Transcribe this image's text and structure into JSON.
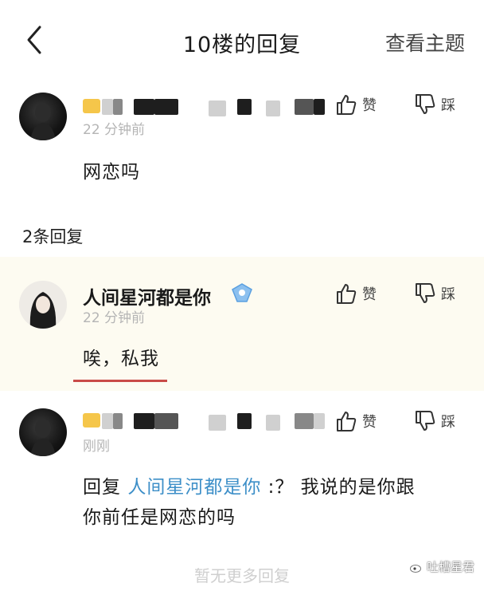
{
  "header": {
    "title": "10楼的回复",
    "right_link": "查看主题"
  },
  "main_comment": {
    "time": "22 分钟前",
    "text": "网恋吗",
    "like_label": "赞",
    "dislike_label": "踩"
  },
  "reply_count": "2条回复",
  "replies": [
    {
      "username": "人间星河都是你",
      "time": "22 分钟前",
      "text": "唉，私我",
      "like_label": "赞",
      "dislike_label": "踩"
    },
    {
      "time": "刚刚",
      "reply_prefix": "回复",
      "reply_to": "人间星河都是你",
      "text_line1": ":？ 我说的是你跟",
      "text_line2": "你前任是网恋的吗",
      "like_label": "赞",
      "dislike_label": "踩"
    }
  ],
  "footer": {
    "no_more": "暂无更多回复",
    "watermark": "吐槽星君"
  }
}
